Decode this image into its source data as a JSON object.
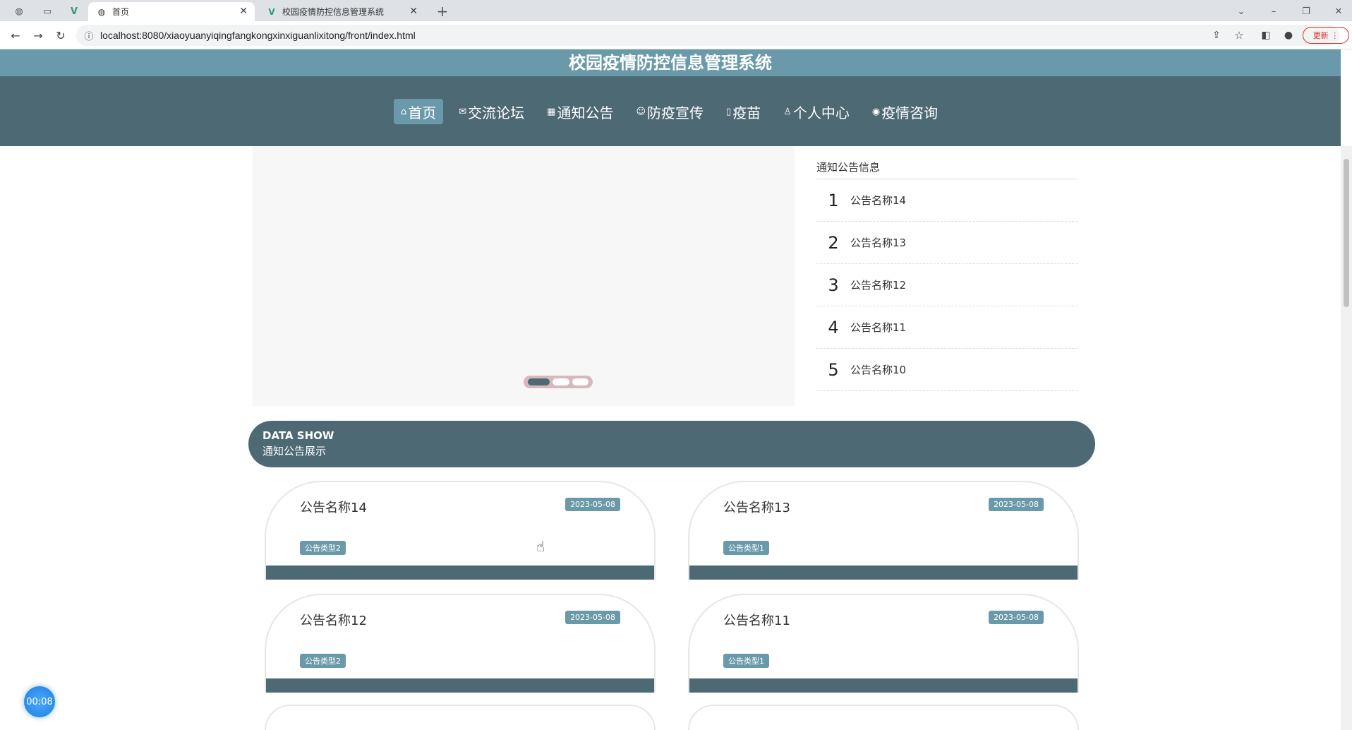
{
  "browser": {
    "tabs": [
      {
        "label": "首页",
        "active": true
      },
      {
        "label": "校园疫情防控信息管理系统",
        "active": false
      }
    ],
    "url": "localhost:8080/xiaoyuanyiqingfangkongxinxiguanlixitong/front/index.html",
    "update_label": "更新"
  },
  "site": {
    "title": "校园疫情防控信息管理系统",
    "nav": [
      {
        "label": "首页",
        "icon": "home-icon"
      },
      {
        "label": "交流论坛",
        "icon": "mail-icon"
      },
      {
        "label": "通知公告",
        "icon": "grid-icon"
      },
      {
        "label": "防疫宣传",
        "icon": "smile-icon"
      },
      {
        "label": "疫苗",
        "icon": "tag-icon"
      },
      {
        "label": "个人中心",
        "icon": "user-icon"
      },
      {
        "label": "疫情咨询",
        "icon": "globe-icon"
      }
    ]
  },
  "notice_list": {
    "title": "通知公告信息",
    "items": [
      {
        "num": "1",
        "name": "公告名称14"
      },
      {
        "num": "2",
        "name": "公告名称13"
      },
      {
        "num": "3",
        "name": "公告名称12"
      },
      {
        "num": "4",
        "name": "公告名称11"
      },
      {
        "num": "5",
        "name": "公告名称10"
      }
    ]
  },
  "section": {
    "en": "DATA SHOW",
    "cn": "通知公告展示"
  },
  "cards": [
    {
      "title": "公告名称14",
      "date": "2023-05-08",
      "type": "公告类型2"
    },
    {
      "title": "公告名称13",
      "date": "2023-05-08",
      "type": "公告类型1"
    },
    {
      "title": "公告名称12",
      "date": "2023-05-08",
      "type": "公告类型2"
    },
    {
      "title": "公告名称11",
      "date": "2023-05-08",
      "type": "公告类型1"
    }
  ],
  "timer": "00:08",
  "colors": {
    "header": "#6a9aa9",
    "nav": "#4d6974",
    "accent": "#6a9aa9"
  }
}
